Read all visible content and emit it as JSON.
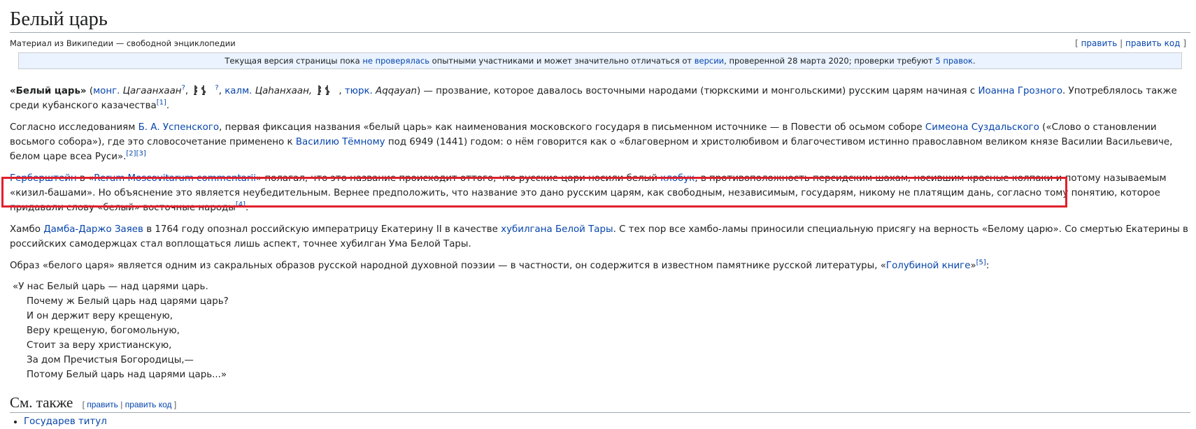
{
  "title": "Белый царь",
  "subtitle": "Материал из Википедии — свободной энциклопедии",
  "edit": {
    "open": "[",
    "edit": "править",
    "sep": "|",
    "edit_code": "править код",
    "close": "]"
  },
  "notice": {
    "t1": "Текущая версия страницы пока ",
    "link1": "не проверялась",
    "t2": " опытными участниками и может значительно отличаться от ",
    "link2": "версии",
    "t3": ", проверенной 28 марта 2020; проверки требуют ",
    "link3": "5 правок",
    "t4": "."
  },
  "p1": {
    "bold": "«Белый царь»",
    "paren_open": " (",
    "mong_link": "монг.",
    "mong_word": " Цагаанхаан",
    "q1": "?",
    "comma1": ", ",
    "comma2": ", ",
    "q2": "?",
    "kalm_link": "калм.",
    "kalm_word": " Цаһанхаан, ",
    "comma3": ", ",
    "turk_link": "тюрк.",
    "turk_word": " Aqqayan",
    "t1": ") — прозвание, которое давалось восточными народами (тюркскими и монгольскими) русским царям начиная с ",
    "ivan_link": "Иоанна Грозного",
    "t2": ". Употреблялось также среди кубанского казачества",
    "ref1": "[1]",
    "t3": "."
  },
  "p2": {
    "t1": "Согласно исследованиям ",
    "link1": "Б. А. Успенского",
    "t2": ", первая фиксация названия «белый царь» как наименования московского государя в письменном источнике — в Повести об осьмом соборе ",
    "link2": "Симеона Суздальского",
    "t3": " («Слово о становлении восьмого собора»), где это словосочетание применено к ",
    "link3": "Василию Тёмному",
    "t4": " под 6949 (1441) годом: о нём говорится как о «благоверном и христолюбивом и благочестивом истинно православном великом князе Василии Васильевиче, белом царе всеа Руси».",
    "ref2": "[2]",
    "ref3": "[3]"
  },
  "p3": {
    "link1": "Герберштейн",
    "t1": " в «",
    "link2": "Rerum Moscovitarum commentarii",
    "t2": "» полагал, что это название происходит оттого, что русские цари носили белый ",
    "link3": "клобук",
    "t3": ", в противоположность персидским шахам, носившим красные колпаки и потому называемым «кизил-башами». Но объяснение это является неубедительным. Вернее предположить, что название это дано русским царям, как свободным, независимым, государям, никому не платящим дань, согласно тому понятию, которое придавали слову «белый» восточные народы",
    "ref4": "[4]",
    "t4": "."
  },
  "p4": {
    "t1": "Хамбо ",
    "link1": "Дамба-Даржо Заяев",
    "t2": " в 1764 году опознал российскую императрицу Екатерину II в качестве ",
    "link2": "хубилгана Белой Тары",
    "t3": ". С тех пор все хамбо-ламы приносили специальную присягу на верность «Белому царю». Со смертью Екатерины в российских самодержцах стал воплощаться лишь аспект, точнее хубилган Ума Белой Тары."
  },
  "p5": {
    "t1": "Образ «белого царя» является одним из сакральных образов русской народной духовной поэзии — в частности, он содержится в известном памятнике русской литературы, «",
    "link1": "Голубиной книге",
    "t2": "»",
    "ref5": "[5]",
    "t3": ":"
  },
  "poem": [
    "«У нас Белый царь — над царями царь.",
    "Почему ж Белый царь над царями царь?",
    "И он держит веру крещеную,",
    "Веру крещеную, богомольную,",
    "Стоит за веру христианскую,",
    "За дом Пречистыя Богородицы,—",
    "Потому Белый царь над царями царь...»"
  ],
  "see_also": {
    "heading": "См. также",
    "edit_open": "[ ",
    "edit": "править",
    "sep": " | ",
    "edit_code": "править код",
    "edit_close": " ]",
    "items": [
      "Государев титул"
    ]
  },
  "colors": {
    "link": "#0645ad",
    "highlight_border": "#e0202c",
    "notice_bg": "#eaf3ff"
  },
  "icons": {
    "mongolian_script": "mongolian-script-glyph"
  }
}
